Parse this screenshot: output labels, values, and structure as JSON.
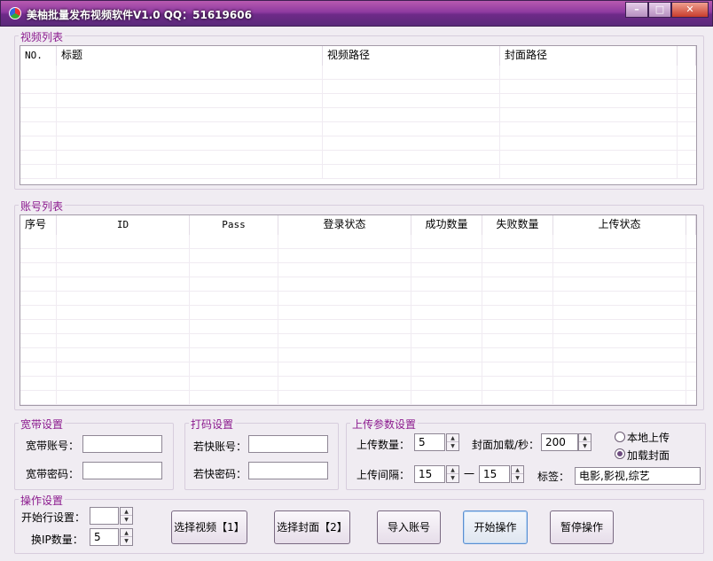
{
  "window": {
    "title": "美柚批量发布视频软件V1.0 QQ：51619606"
  },
  "video_list": {
    "group_title": "视频列表",
    "columns": [
      "NO.",
      "标题",
      "视频路径",
      "封面路径"
    ],
    "rows": []
  },
  "account_list": {
    "group_title": "账号列表",
    "columns": [
      "序号",
      "ID",
      "Pass",
      "登录状态",
      "成功数量",
      "失败数量",
      "上传状态"
    ],
    "rows": []
  },
  "broadband": {
    "group_title": "宽带设置",
    "account_label": "宽带账号：",
    "account_value": "",
    "password_label": "宽带密码：",
    "password_value": ""
  },
  "captcha": {
    "group_title": "打码设置",
    "account_label": "若快账号：",
    "account_value": "",
    "password_label": "若快密码：",
    "password_value": ""
  },
  "upload_params": {
    "group_title": "上传参数设置",
    "count_label": "上传数量：",
    "count_value": "5",
    "cover_load_label": "封面加载/秒：",
    "cover_load_value": "200",
    "interval_label": "上传间隔：",
    "interval_min": "15",
    "interval_sep": "一",
    "interval_max": "15",
    "tags_label": "标签：",
    "tags_value": "电影,影视,综艺",
    "radio_local": "本地上传",
    "radio_load_cover": "加载封面",
    "selected_radio": "加载封面"
  },
  "operation": {
    "group_title": "操作设置",
    "start_row_label": "开始行设置：",
    "start_row_value": "",
    "ip_count_label": "换IP数量：",
    "ip_count_value": "5"
  },
  "buttons": {
    "select_video": "选择视频【1】",
    "select_cover": "选择封面【2】",
    "import_accounts": "导入账号",
    "start": "开始操作",
    "pause": "暂停操作"
  }
}
